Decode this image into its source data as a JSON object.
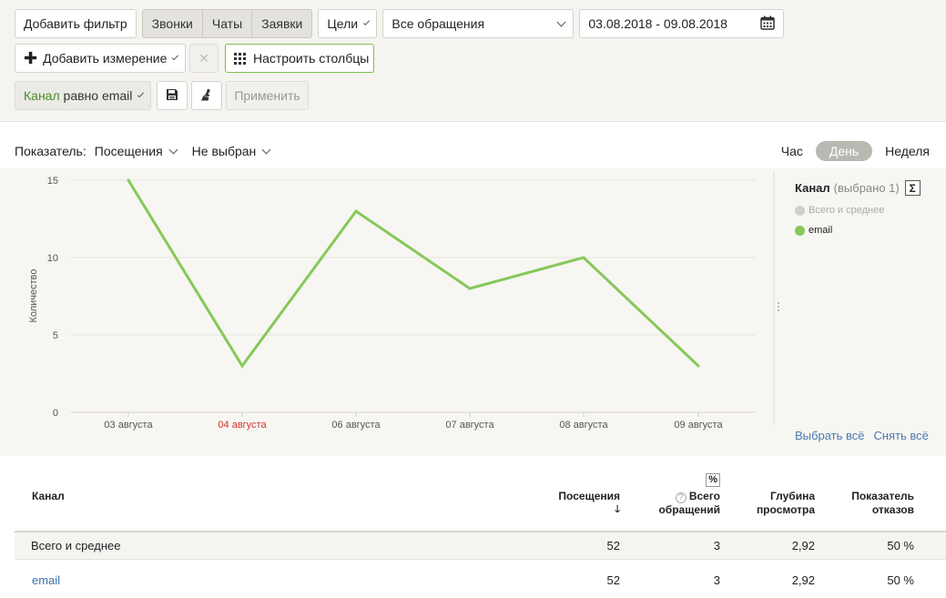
{
  "toolbar": {
    "add_filter": "Добавить фильтр",
    "types": [
      "Звонки",
      "Чаты",
      "Заявки"
    ],
    "goals": "Цели",
    "requests_select": "Все обращения",
    "date_range": "03.08.2018 - 09.08.2018",
    "add_dimension": "Добавить измерение",
    "clear_symbol": "✕",
    "configure_columns": "Настроить столбцы",
    "filter_chip_field": "Канал",
    "filter_chip_rest": " равно email",
    "apply": "Применить"
  },
  "chart_controls": {
    "metric_label": "Показатель:",
    "metric_value": "Посещения",
    "metric2_value": "Не выбран",
    "periods": [
      "Час",
      "День",
      "Неделя"
    ],
    "active_period": "День"
  },
  "legend": {
    "title": "Канал",
    "subtitle": "(выбрано 1)",
    "sigma": "Σ",
    "items": [
      {
        "label": "Всего и среднее",
        "color": "#cfcfcf"
      },
      {
        "label": "email",
        "color": "#86c85a"
      }
    ],
    "select_all": "Выбрать всё",
    "deselect_all": "Снять всё"
  },
  "chart_data": {
    "type": "line",
    "categories": [
      "03 августа",
      "04 августа",
      "06 августа",
      "07 августа",
      "08 августа",
      "09 августа"
    ],
    "highlight_category": "04 августа",
    "series": [
      {
        "values": [
          15,
          3,
          13,
          8,
          10,
          3
        ],
        "color": "#86c85a"
      }
    ],
    "ylabel": "Количество",
    "yticks": [
      0,
      5,
      10,
      15
    ],
    "ylim": [
      0,
      15
    ],
    "grid": true
  },
  "table": {
    "headers": {
      "channel": "Канал",
      "visits": "Посещения",
      "visits_sort": "🡓",
      "total_pct": "%",
      "total_help": "?",
      "total_line1": "Всего",
      "total_line2": "обращений",
      "depth_line1": "Глубина",
      "depth_line2": "просмотра",
      "bounce_line1": "Показатель",
      "bounce_line2": "отказов"
    },
    "rows": [
      {
        "channel": "Всего и среднее",
        "visits": "52",
        "total": "3",
        "depth": "2,92",
        "bounce": "50 %"
      },
      {
        "channel": "email",
        "visits": "52",
        "total": "3",
        "depth": "2,92",
        "bounce": "50 %"
      }
    ]
  }
}
